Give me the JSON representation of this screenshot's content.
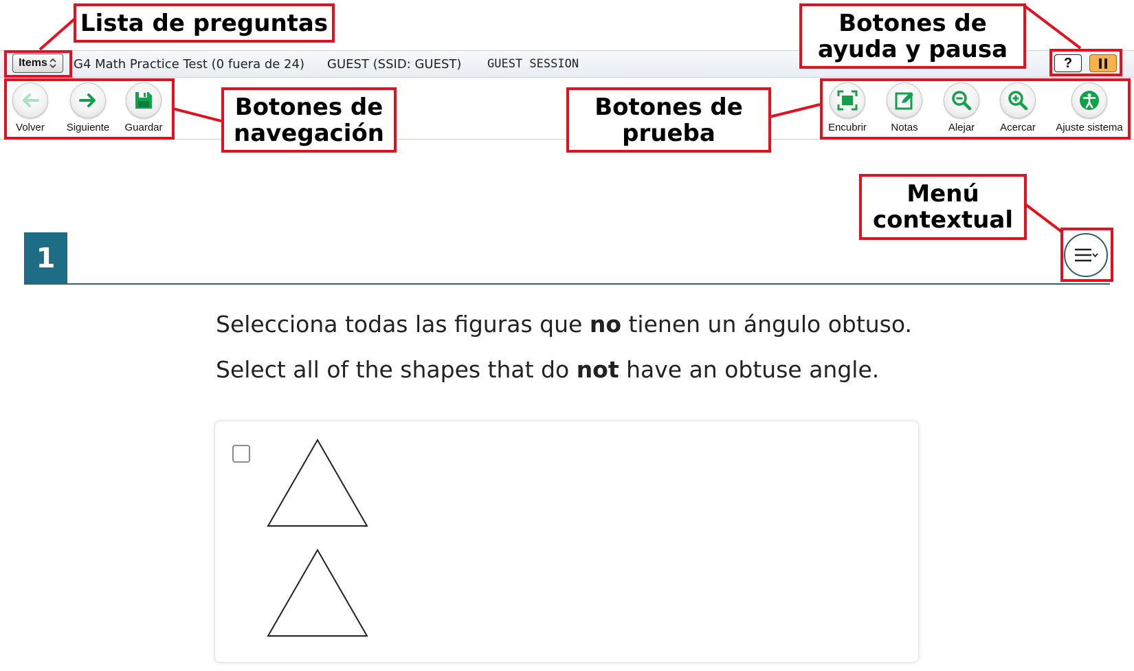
{
  "header": {
    "items_label": "Items",
    "test_info": "G4 Math Practice Test (0 fuera de 24)",
    "guest_info": "GUEST (SSID: GUEST)",
    "session_info": "GUEST SESSION",
    "help_label": "?"
  },
  "nav_buttons": [
    {
      "label": "Volver",
      "icon": "arrow-left-icon",
      "color": "#a9e3c4"
    },
    {
      "label": "Siguiente",
      "icon": "arrow-right-icon",
      "color": "#11a14a"
    },
    {
      "label": "Guardar",
      "icon": "save-icon",
      "color": "#11a14a"
    }
  ],
  "test_tools": [
    {
      "label": "Encubrir",
      "icon": "mask-icon"
    },
    {
      "label": "Notas",
      "icon": "notes-icon"
    },
    {
      "label": "Alejar",
      "icon": "zoom-out-icon"
    },
    {
      "label": "Acercar",
      "icon": "zoom-in-icon"
    },
    {
      "label": "Ajuste sistema",
      "icon": "accessibility-icon"
    }
  ],
  "annotations": {
    "question_list": "Lista de preguntas",
    "help_pause_line1": "Botones de",
    "help_pause_line2": "ayuda y pausa",
    "navigation_line1": "Botones de",
    "navigation_line2": "navegación",
    "test_line1": "Botones de",
    "test_line2": "prueba",
    "context_line1": "Menú",
    "context_line2": "contextual"
  },
  "question": {
    "number": "1",
    "prompt_es_before": "Selecciona todas las figuras que ",
    "prompt_es_bold": "no",
    "prompt_es_after": " tienen un ángulo obtuso.",
    "prompt_en_before": "Select all of the shapes that do ",
    "prompt_en_bold": "not",
    "prompt_en_after": " have an obtuse angle."
  },
  "colors": {
    "annotation_red": "#e3101f",
    "tool_green": "#11a14a",
    "question_badge": "#1d6d86",
    "pause_orange": "#f7b24a"
  }
}
